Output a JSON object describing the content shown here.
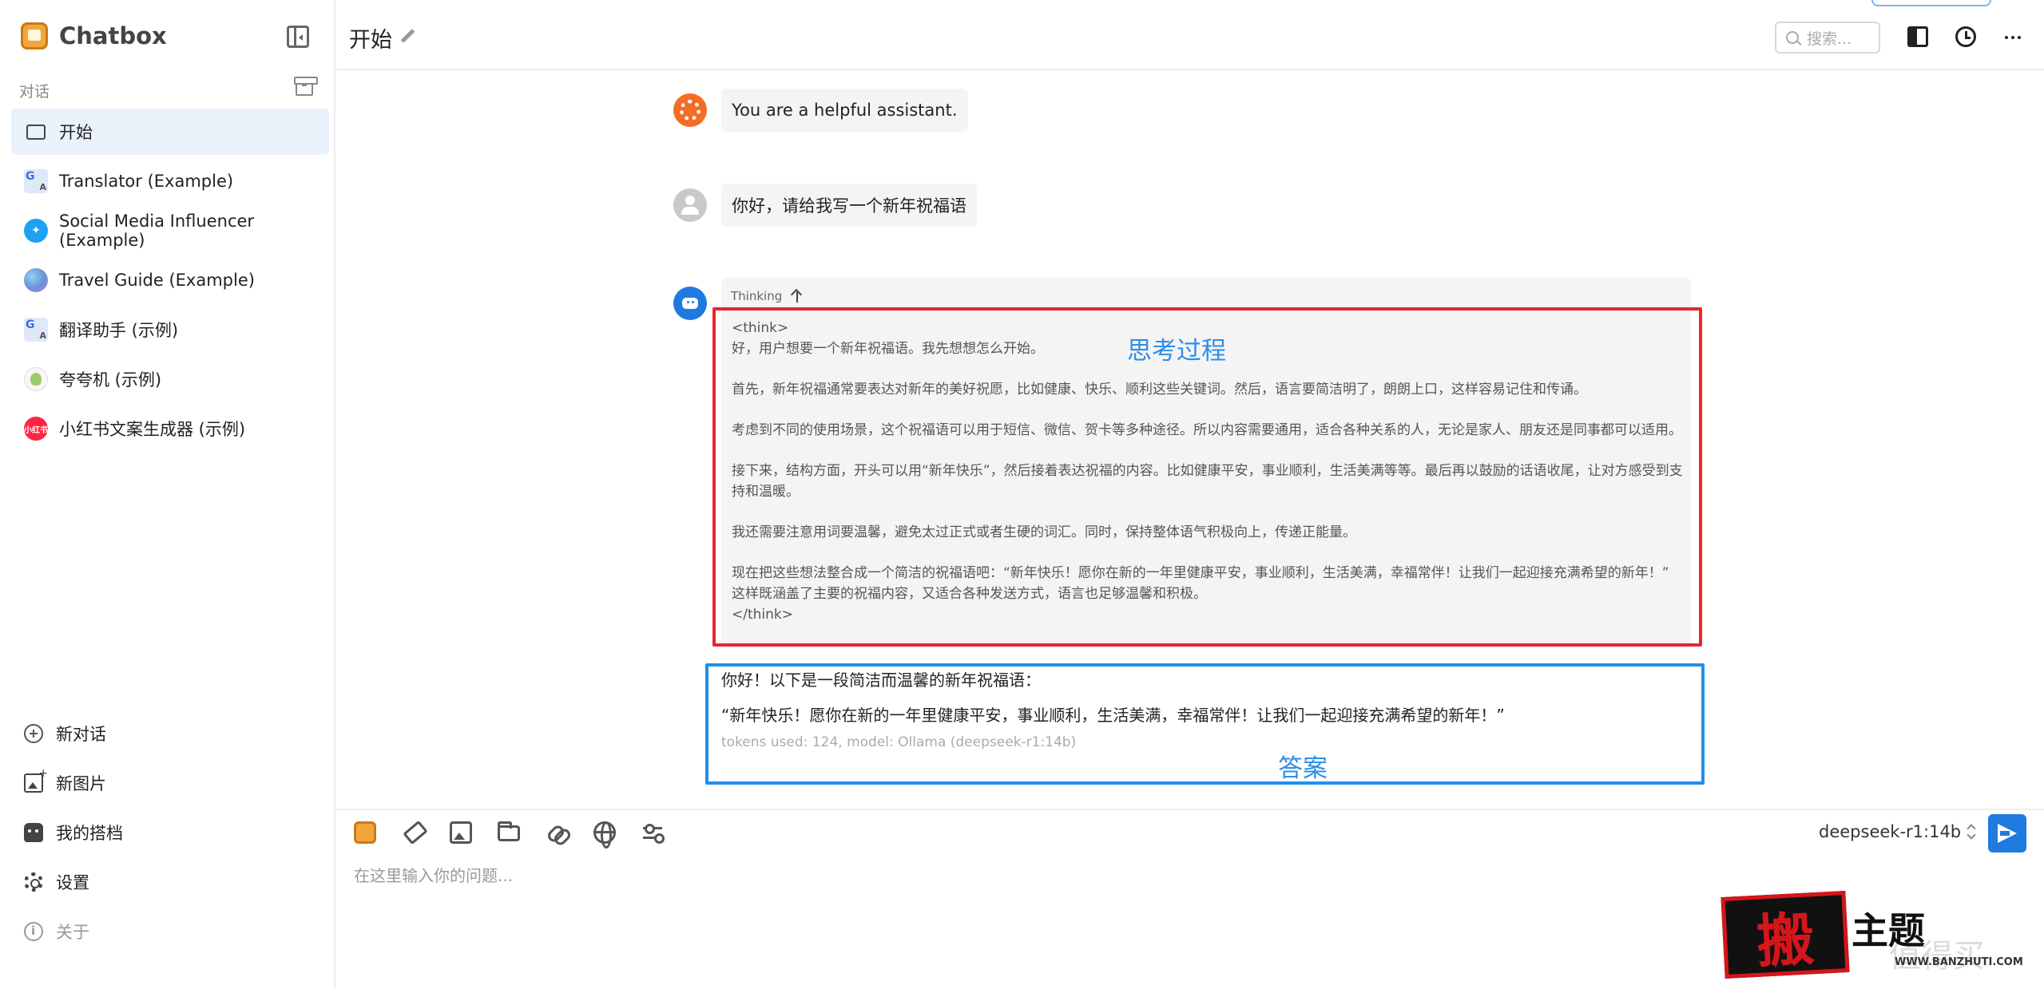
{
  "app": {
    "name": "Chatbox"
  },
  "sidebar": {
    "section_label": "对话",
    "conversations": [
      {
        "label": "开始",
        "icon": "chat-bubble-icon",
        "active": true
      },
      {
        "label": "Translator (Example)",
        "icon": "translate-icon"
      },
      {
        "label": "Social Media Influencer (Example)",
        "icon": "twitter-icon"
      },
      {
        "label": "Travel Guide (Example)",
        "icon": "globe-icon"
      },
      {
        "label": "翻译助手 (示例)",
        "icon": "translate-icon"
      },
      {
        "label": "夸夸机 (示例)",
        "icon": "bird-icon"
      },
      {
        "label": "小红书文案生成器 (示例)",
        "icon": "xiaohongshu-icon",
        "badge_text": "小红书"
      }
    ],
    "bottom": {
      "new_chat": "新对话",
      "new_image": "新图片",
      "my_partner": "我的搭档",
      "settings": "设置",
      "about": "关于"
    }
  },
  "header": {
    "title": "开始",
    "search_placeholder": "搜索..."
  },
  "messages": {
    "system": "You are a helpful assistant.",
    "user": "你好，请给我写一个新年祝福语",
    "assistant": {
      "thinking_label": "Thinking",
      "thinking_lines": [
        "<think>",
        "好，用户想要一个新年祝福语。我先想想怎么开始。",
        "",
        "首先，新年祝福通常要表达对新年的美好祝愿，比如健康、快乐、顺利这些关键词。然后，语言要简洁明了，朗朗上口，这样容易记住和传诵。",
        "",
        "考虑到不同的使用场景，这个祝福语可以用于短信、微信、贺卡等多种途径。所以内容需要通用，适合各种关系的人，无论是家人、朋友还是同事都可以适用。",
        "",
        "接下来，结构方面，开头可以用“新年快乐”，然后接着表达祝福的内容。比如健康平安，事业顺利，生活美满等等。最后再以鼓励的话语收尾，让对方感受到支持和温暖。",
        "",
        "我还需要注意用词要温馨，避免太过正式或者生硬的词汇。同时，保持整体语气积极向上，传递正能量。",
        "",
        "现在把这些想法整合成一个简洁的祝福语吧：“新年快乐！愿你在新的一年里健康平安，事业顺利，生活美满，幸福常伴！让我们一起迎接充满希望的新年！” 这样既涵盖了主要的祝福内容，又适合各种发送方式，语言也足够温馨和积极。",
        "</think>"
      ],
      "answer_line1": "你好！以下是一段简洁而温馨的新年祝福语：",
      "answer_line2": "“新年快乐！愿你在新的一年里健康平安，事业顺利，生活美满，幸福常伴！让我们一起迎接充满希望的新年！”",
      "meta": "tokens used: 124, model: Ollama (deepseek-r1:14b)"
    }
  },
  "annotations": {
    "thinking_caption": "思考过程",
    "answer_caption": "答案",
    "thinking_box_color": "#e8262a",
    "answer_box_color": "#1e8ff0"
  },
  "input": {
    "model": "deepseek-r1:14b",
    "placeholder": "在这里输入你的问题..."
  },
  "watermark": {
    "char": "搬",
    "text": "主题",
    "faint": "值得买",
    "url": "WWW.BANZHUTI.COM"
  },
  "colors": {
    "accent": "#1f7ae0",
    "active_item_bg": "#e9f1fb",
    "system_avatar": "#f36d24"
  }
}
